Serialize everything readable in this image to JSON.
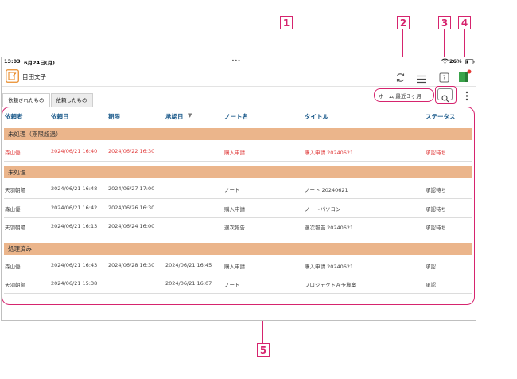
{
  "callouts": [
    "1",
    "2",
    "3",
    "4",
    "5"
  ],
  "status_bar": {
    "time": "13:03",
    "date": "6月24日(月)",
    "dots": "•••",
    "battery": "26%"
  },
  "app": {
    "user_name": "目田文子"
  },
  "tabs": [
    {
      "label": "依頼されたもの"
    },
    {
      "label": "依頼したもの"
    }
  ],
  "filter": {
    "label": "ホーム 最近３ヶ月"
  },
  "columns": {
    "requester": "依頼者",
    "request_date": "依頼日",
    "due": "期限",
    "approved": "承認日",
    "sort_arrow": "▼",
    "note_name": "ノート名",
    "title": "タイトル",
    "status": "ステータス"
  },
  "groups": [
    {
      "label": "未処理（期限超過）",
      "rows": [
        {
          "requester": "森山優",
          "request_date": "2024/06/21 16:40",
          "due": "2024/06/22 16:30",
          "approved": "",
          "note_name": "購入申請",
          "title": "購入申請 20240621",
          "status": "承認待ち"
        }
      ]
    },
    {
      "label": "未処理",
      "rows": [
        {
          "requester": "天羽朝陽",
          "request_date": "2024/06/21 16:48",
          "due": "2024/06/27 17:00",
          "approved": "",
          "note_name": "ノート",
          "title": "ノート 20240621",
          "status": "承認待ち"
        },
        {
          "requester": "森山優",
          "request_date": "2024/06/21 16:42",
          "due": "2024/06/26 16:30",
          "approved": "",
          "note_name": "購入申請",
          "title": "ノートパソコン",
          "status": "承認待ち"
        },
        {
          "requester": "天羽朝陽",
          "request_date": "2024/06/21 16:13",
          "due": "2024/06/24 16:00",
          "approved": "",
          "note_name": "週次報告",
          "title": "週次報告 20240621",
          "status": "承認待ち"
        }
      ]
    },
    {
      "label": "処理済み",
      "rows": [
        {
          "requester": "森山優",
          "request_date": "2024/06/21 16:43",
          "due": "2024/06/28 16:30",
          "approved": "2024/06/21 16:45",
          "note_name": "購入申請",
          "title": "購入申請 20240621",
          "status": "承認"
        },
        {
          "requester": "天羽朝陽",
          "request_date": "2024/06/21 15:38",
          "due": "",
          "approved": "2024/06/21 16:07",
          "note_name": "ノート",
          "title": "プロジェクトＡ予算案",
          "status": "承認"
        }
      ]
    }
  ],
  "icons": [
    "sync-icon",
    "list-icon",
    "help-icon",
    "app-logo-icon",
    "search-icon",
    "more-vertical-icon",
    "user-note-icon",
    "wifi-icon",
    "battery-icon"
  ],
  "colors": {
    "accent": "#d6246e",
    "group_header": "#ebb58b",
    "header_text": "#1f5d8d",
    "overdue_text": "#e03a3a",
    "logo_orange": "#e98c2b"
  }
}
